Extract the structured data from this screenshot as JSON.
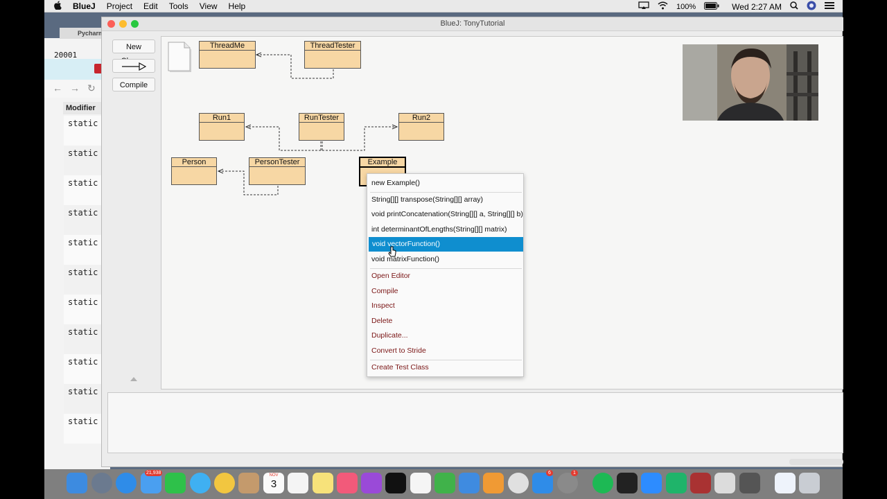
{
  "menubar": {
    "app_name": "BlueJ",
    "menus": [
      "Project",
      "Edit",
      "Tools",
      "View",
      "Help"
    ],
    "battery": "100%",
    "clock": "Wed 2:27 AM"
  },
  "background_window": {
    "app_tab": "Pycharm",
    "terminal_text": "20001",
    "column_header": "Modifier",
    "rows": [
      "static :",
      "static i",
      "static c",
      "static i",
      "static c",
      "static c",
      "static c",
      "static c",
      "static c",
      "static i",
      "static c"
    ]
  },
  "window": {
    "title": "BlueJ:  TonyTutorial",
    "buttons": {
      "new_class": "New Class...",
      "arrow": "—▷",
      "compile": "Compile"
    }
  },
  "classes": {
    "threadme": "ThreadMe",
    "threadtester": "ThreadTester",
    "run1": "Run1",
    "runtester": "RunTester",
    "run2": "Run2",
    "person": "Person",
    "persontester": "PersonTester",
    "example": "Example"
  },
  "context_menu": {
    "constructor": "new Example()",
    "methods": [
      "String[][] transpose(String[][] array)",
      "void printConcatenation(String[][] a, String[][] b)",
      "int determinantOfLengths(String[][] matrix)",
      "void vectorFunction()",
      "void matrixFunction()"
    ],
    "highlighted": "void vectorFunction()",
    "actions": [
      "Open Editor",
      "Compile",
      "Inspect",
      "Delete",
      "Duplicate...",
      "Convert to Stride"
    ],
    "create_test_class": "Create Test Class"
  },
  "dock": {
    "mail_badge": "21,938",
    "calendar_month": "NOV",
    "calendar_day": "3",
    "app_store_badge": "6",
    "settings_badge": "1",
    "icons": [
      "finder-icon",
      "launchpad-icon",
      "safari-icon",
      "mail-icon",
      "facetime-icon",
      "messages-icon",
      "photos-icon",
      "contacts-icon",
      "calendar-icon",
      "reminders-icon",
      "notes-icon",
      "music-icon",
      "podcasts-icon",
      "tv-icon",
      "news-icon",
      "numbers-icon",
      "keynote-icon",
      "pages-icon",
      "chrome-icon",
      "appstore-icon",
      "system-preferences-icon",
      "spotify-icon",
      "terminal-icon",
      "zoom-icon",
      "pycharm-icon",
      "dictionary-icon",
      "bluej-icon",
      "screenshot-icon",
      "documents-folder-icon",
      "trash-icon"
    ]
  },
  "colors": {
    "class_fill": "#f7d7a4",
    "menu_highlight": "#0f8ecf",
    "action_text": "#7a1515"
  }
}
